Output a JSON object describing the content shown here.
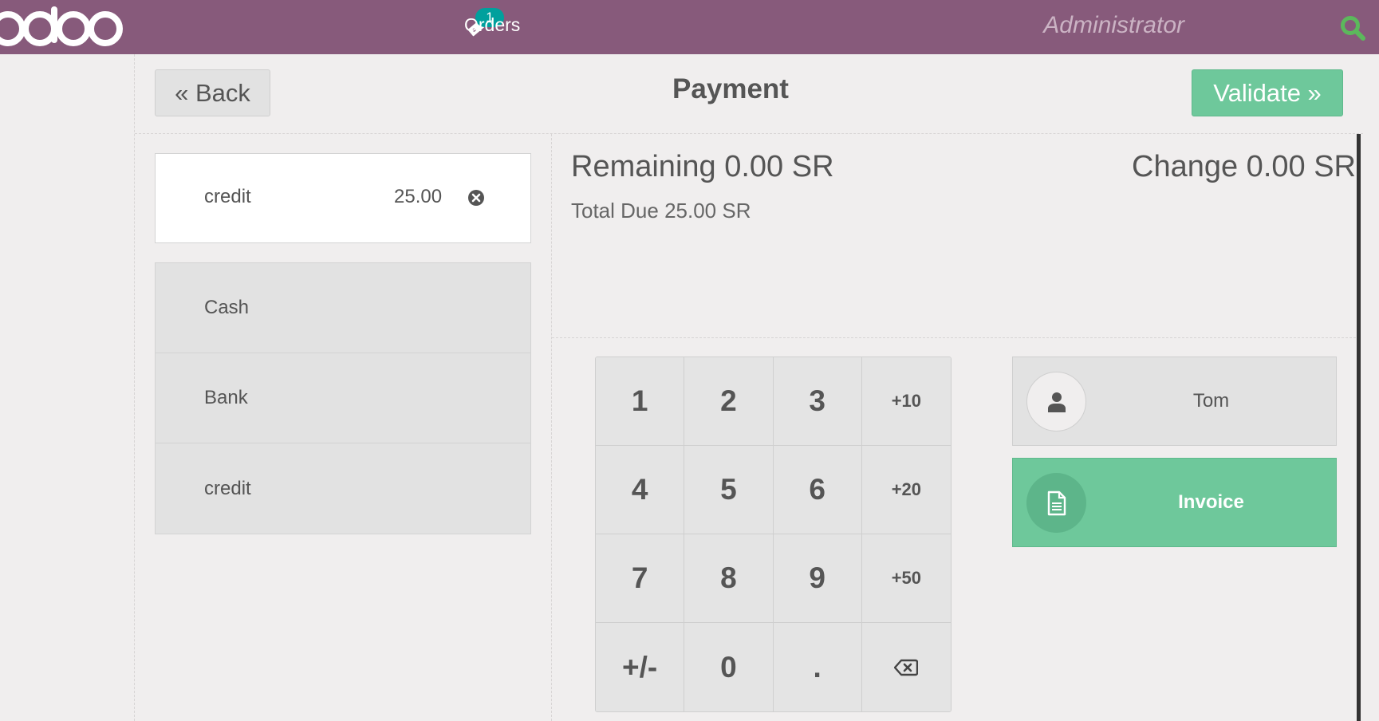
{
  "topbar": {
    "logo_text": "odoo",
    "orders_badge": "1",
    "orders_label": "Orders",
    "user_label": "Administrator",
    "bar_color": "#875a7b",
    "badge_color": "#00a09d",
    "search_icon_color": "#5cb85c"
  },
  "header": {
    "back_label": "« Back",
    "title": "Payment",
    "validate_label": "Validate »"
  },
  "paymentline": {
    "method": "credit",
    "amount": "25.00"
  },
  "payment_methods": [
    "Cash",
    "Bank",
    "credit"
  ],
  "status": {
    "remaining": "Remaining 0.00 SR",
    "change": "Change 0.00 SR",
    "total_due": "Total Due  25.00 SR"
  },
  "numpad": [
    "1",
    "2",
    "3",
    "+10",
    "4",
    "5",
    "6",
    "+20",
    "7",
    "8",
    "9",
    "+50",
    "+/-",
    "0",
    ".",
    "⌫"
  ],
  "customer": {
    "name": "Tom"
  },
  "invoice": {
    "label": "Invoice"
  },
  "colors": {
    "accent_green": "#6ec89b",
    "panel_gray": "#e2e2e2",
    "background": "#f0eeee"
  }
}
